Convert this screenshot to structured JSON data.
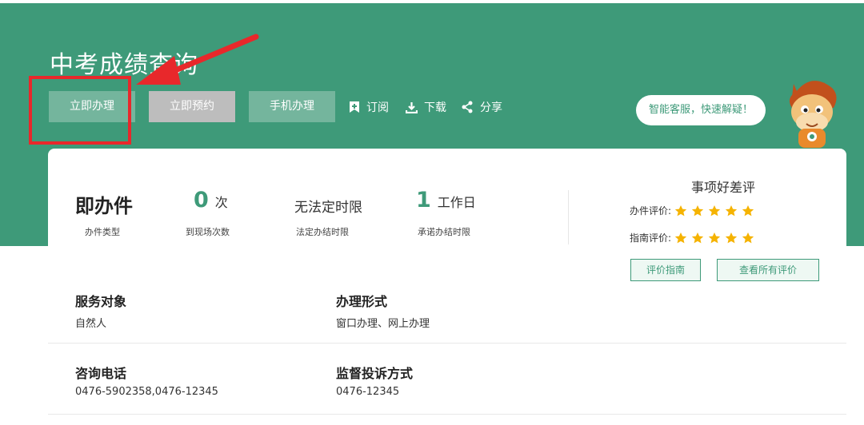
{
  "page": {
    "title": "中考成绩查询",
    "buttons": {
      "handle": "立即办理",
      "reserve": "立即预约",
      "mobile": "手机办理"
    },
    "actions": {
      "subscribe": "订阅",
      "download": "下载",
      "share": "分享"
    },
    "chat_bubble": "智能客服，快速解疑！"
  },
  "stats": {
    "type_value": "即办件",
    "type_label": "办件类型",
    "visits_value": "0",
    "visits_unit": "次",
    "visits_label": "到现场次数",
    "legal_value": "无法定时限",
    "legal_label": "法定办结时限",
    "promise_value": "1",
    "promise_unit": "工作日",
    "promise_label": "承诺办结时限"
  },
  "rating": {
    "title": "事项好差评",
    "handling_label": "办件评价:",
    "handling_stars": 5,
    "guide_label": "指南评价:",
    "guide_stars": 5,
    "btn_guide": "评价指南",
    "btn_all": "查看所有评价"
  },
  "info": {
    "target_label": "服务对象",
    "target_value": "自然人",
    "form_label": "办理形式",
    "form_value": "窗口办理、网上办理",
    "phone_label": "咨询电话",
    "phone_value": "0476-5902358,0476-12345",
    "complaint_label": "监督投诉方式",
    "complaint_value": "0476-12345"
  },
  "colors": {
    "brand_green": "#3e9a79",
    "star": "#f5b301",
    "callout": "#e8282b"
  }
}
